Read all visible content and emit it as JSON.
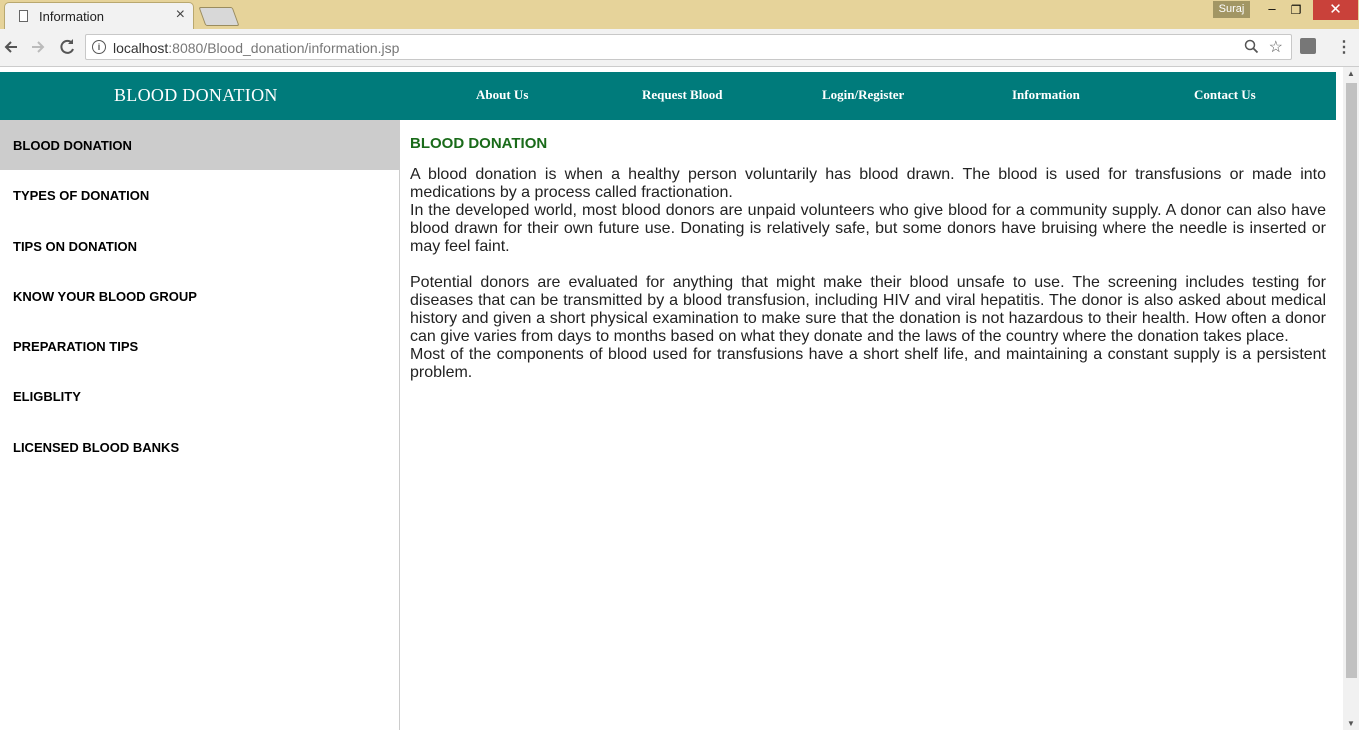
{
  "browser": {
    "tab_title": "Information",
    "tab_close": "×",
    "user_name": "Suraj",
    "window_min": "‒",
    "window_max": "❐",
    "window_close": "✕",
    "url_host": "localhost",
    "url_rest": ":8080/Blood_donation/information.jsp",
    "icons": [
      "back-icon",
      "forward-icon",
      "reload-icon",
      "info-icon",
      "zoom-icon",
      "star-icon",
      "extension-icon",
      "menu-icon"
    ]
  },
  "header": {
    "site_title": "BLOOD DONATION",
    "nav": [
      "About Us",
      "Request Blood",
      "Login/Register",
      "Information",
      "Contact Us"
    ],
    "bg_color": "#007b7b"
  },
  "sidebar": {
    "items": [
      {
        "label": "BLOOD DONATION",
        "active": true
      },
      {
        "label": "TYPES OF DONATION",
        "active": false
      },
      {
        "label": "TIPS ON DONATION",
        "active": false
      },
      {
        "label": "KNOW YOUR BLOOD GROUP",
        "active": false
      },
      {
        "label": "PREPARATION TIPS",
        "active": false
      },
      {
        "label": "ELIGBLITY",
        "active": false
      },
      {
        "label": "LICENSED BLOOD BANKS",
        "active": false
      }
    ]
  },
  "content": {
    "title": "BLOOD DONATION",
    "title_color": "#1a6b1a",
    "paragraphs": [
      "A blood donation is when a healthy person voluntarily has blood drawn. The blood is used for transfusions or made into medications by a process called fractionation.",
      "In the developed world, most blood donors are unpaid volunteers who give blood for a community supply. A donor can also have blood drawn for their own future use. Donating is relatively safe, but some donors have bruising where the needle is inserted or may feel faint.",
      "Potential donors are evaluated for anything that might make their blood unsafe to use. The screening includes testing for diseases that can be transmitted by a blood transfusion, including HIV and viral hepatitis. The donor is also asked about medical history and given a short physical examination to make sure that the donation is not hazardous to their health. How often a donor can give varies from days to months based on what they donate and the laws of the country where the donation takes place.",
      "Most of the components of blood used for transfusions have a short shelf life, and maintaining a constant supply is a persistent problem."
    ]
  }
}
